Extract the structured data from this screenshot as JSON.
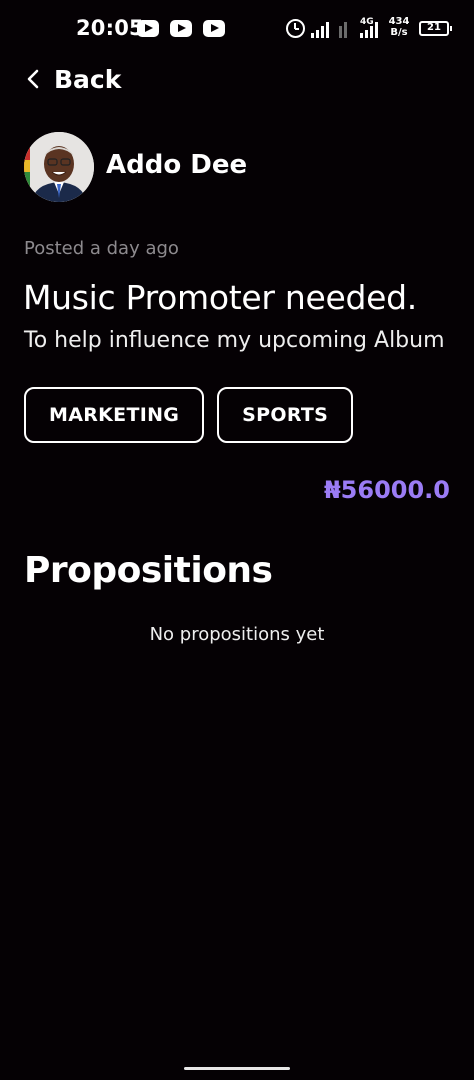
{
  "status_bar": {
    "time": "20:05",
    "network_type": "4G",
    "speed_value": "434",
    "speed_unit": "B/s",
    "battery_level": "21",
    "icons": [
      "youtube-icon",
      "youtube-icon",
      "youtube-icon",
      "alarm-icon",
      "signal-icon",
      "signal-icon",
      "battery-icon"
    ]
  },
  "nav": {
    "back_label": "Back",
    "back_icon": "chevron-left-icon"
  },
  "post": {
    "author_name": "Addo Dee",
    "posted_time": "Posted a day ago",
    "title": "Music Promoter needed.",
    "description": "To help influence my upcoming Album",
    "tags": [
      "MARKETING",
      "SPORTS"
    ],
    "price": "₦56000.0"
  },
  "propositions": {
    "heading": "Propositions",
    "empty_text": "No propositions yet"
  },
  "colors": {
    "background": "#050104",
    "price_accent": "#9b7cf5",
    "muted_text": "#8d8a8e"
  }
}
